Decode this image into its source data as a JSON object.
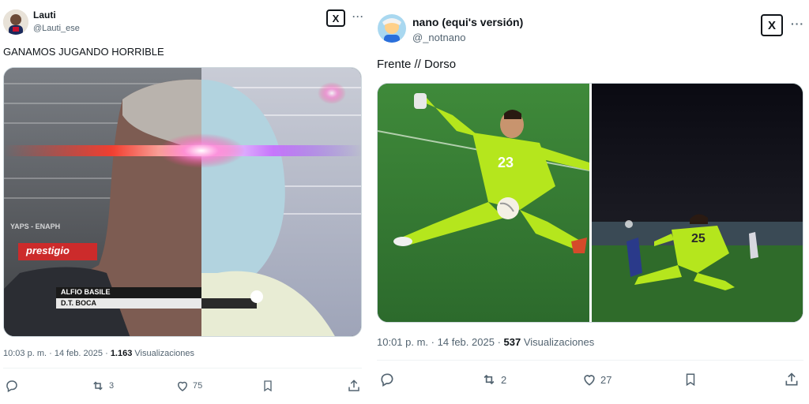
{
  "left_tweet": {
    "display_name": "Lauti",
    "handle": "@Lauti_ese",
    "body": "GANAMOS JUGANDO HORRIBLE",
    "image_caption_line1": "ALFIO BASILE",
    "image_caption_line2": "D.T. BOCA",
    "image_banner_text": "prestigio",
    "image_stands_text": "YAPS - ENAPH",
    "time": "10:03 p. m.",
    "date": "14 feb. 2025",
    "views_count": "1.163",
    "views_label": "Visualizaciones",
    "replies": "",
    "reposts": "3",
    "likes": "75"
  },
  "right_tweet": {
    "display_name": "nano (equi's versión)",
    "handle": "@_notnano",
    "body": "Frente // Dorso",
    "left_jersey_number": "23",
    "right_jersey_number": "25",
    "time": "10:01 p. m.",
    "date": "14 feb. 2025",
    "views_count": "537",
    "views_label": "Visualizaciones",
    "replies": "",
    "reposts": "2",
    "likes": "27"
  },
  "common": {
    "dot": "·",
    "more": "···"
  },
  "icons": [
    "x-logo-icon",
    "more-icon",
    "reply-icon",
    "repost-icon",
    "like-icon",
    "bookmark-icon",
    "share-icon"
  ]
}
